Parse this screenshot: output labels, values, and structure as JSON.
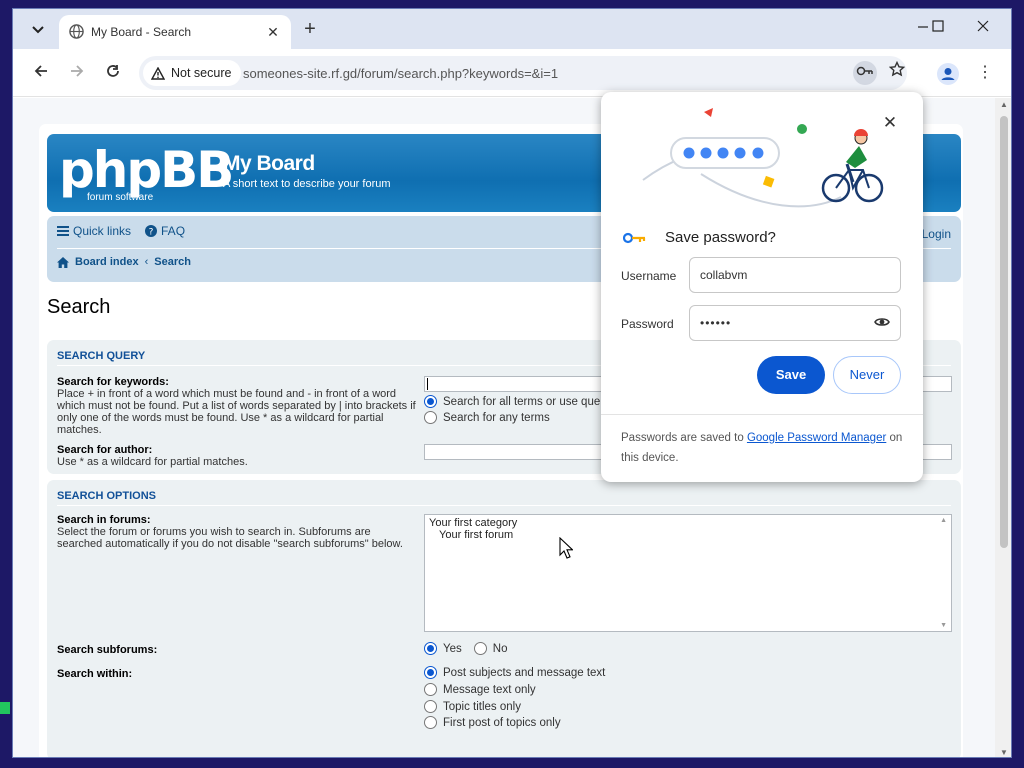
{
  "browser": {
    "tab_title": "My Board - Search",
    "security_label": "Not secure",
    "url": "someones-site.rf.gd/forum/search.php?keywords=&i=1"
  },
  "site": {
    "logo_text": "phpBB",
    "logo_sub": "forum   software",
    "name": "My Board",
    "description": "A short text to describe your forum"
  },
  "nav": {
    "quick_links": "Quick links",
    "faq": "FAQ",
    "login": "Login",
    "breadcrumb_home": "Board index",
    "breadcrumb_sep": "‹",
    "breadcrumb_current": "Search"
  },
  "page_title": "Search",
  "search_query": {
    "heading": "SEARCH QUERY",
    "keywords_label": "Search for keywords:",
    "keywords_help": "Place + in front of a word which must be found and - in front of a word which must not be found. Put a list of words separated by | into brackets if only one of the words must be found. Use * as a wildcard for partial matches.",
    "terms_all": "Search for all terms or use query as entered",
    "terms_any": "Search for any terms",
    "author_label": "Search for author:",
    "author_help": "Use * as a wildcard for partial matches."
  },
  "search_options": {
    "heading": "SEARCH OPTIONS",
    "forums_label": "Search in forums:",
    "forums_help": "Select the forum or forums you wish to search in. Subforums are searched automatically if you do not disable \"search subforums\" below.",
    "forums": [
      "Your first category",
      "  Your first forum"
    ],
    "subforums_label": "Search subforums:",
    "yes": "Yes",
    "no": "No",
    "within_label": "Search within:",
    "within_options": [
      "Post subjects and message text",
      "Message text only",
      "Topic titles only",
      "First post of topics only"
    ]
  },
  "password_popup": {
    "title": "Save password?",
    "username_label": "Username",
    "username_value": "collabvm",
    "password_label": "Password",
    "password_value": "••••••",
    "save": "Save",
    "never": "Never",
    "footer_text": "Passwords are saved to",
    "footer_link": "Google Password Manager",
    "footer_tail": "on this device."
  },
  "colors": {
    "brand": "#0f6fb1",
    "accent": "#0b57d0"
  }
}
